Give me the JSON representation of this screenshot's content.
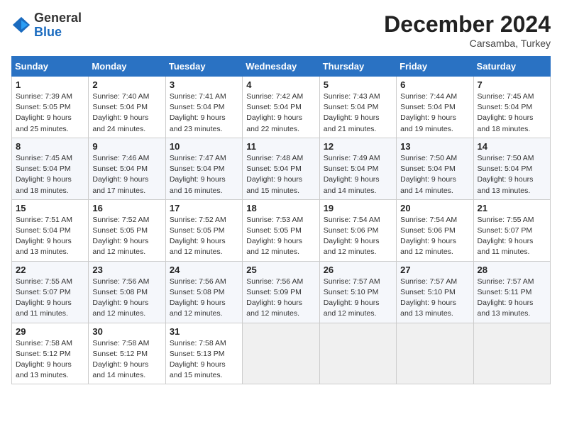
{
  "header": {
    "logo_line1": "General",
    "logo_line2": "Blue",
    "month_title": "December 2024",
    "location": "Carsamba, Turkey"
  },
  "weekdays": [
    "Sunday",
    "Monday",
    "Tuesday",
    "Wednesday",
    "Thursday",
    "Friday",
    "Saturday"
  ],
  "weeks": [
    [
      {
        "day": "1",
        "sunrise": "Sunrise: 7:39 AM",
        "sunset": "Sunset: 5:05 PM",
        "daylight": "Daylight: 9 hours and 25 minutes."
      },
      {
        "day": "2",
        "sunrise": "Sunrise: 7:40 AM",
        "sunset": "Sunset: 5:04 PM",
        "daylight": "Daylight: 9 hours and 24 minutes."
      },
      {
        "day": "3",
        "sunrise": "Sunrise: 7:41 AM",
        "sunset": "Sunset: 5:04 PM",
        "daylight": "Daylight: 9 hours and 23 minutes."
      },
      {
        "day": "4",
        "sunrise": "Sunrise: 7:42 AM",
        "sunset": "Sunset: 5:04 PM",
        "daylight": "Daylight: 9 hours and 22 minutes."
      },
      {
        "day": "5",
        "sunrise": "Sunrise: 7:43 AM",
        "sunset": "Sunset: 5:04 PM",
        "daylight": "Daylight: 9 hours and 21 minutes."
      },
      {
        "day": "6",
        "sunrise": "Sunrise: 7:44 AM",
        "sunset": "Sunset: 5:04 PM",
        "daylight": "Daylight: 9 hours and 19 minutes."
      },
      {
        "day": "7",
        "sunrise": "Sunrise: 7:45 AM",
        "sunset": "Sunset: 5:04 PM",
        "daylight": "Daylight: 9 hours and 18 minutes."
      }
    ],
    [
      {
        "day": "8",
        "sunrise": "Sunrise: 7:45 AM",
        "sunset": "Sunset: 5:04 PM",
        "daylight": "Daylight: 9 hours and 18 minutes."
      },
      {
        "day": "9",
        "sunrise": "Sunrise: 7:46 AM",
        "sunset": "Sunset: 5:04 PM",
        "daylight": "Daylight: 9 hours and 17 minutes."
      },
      {
        "day": "10",
        "sunrise": "Sunrise: 7:47 AM",
        "sunset": "Sunset: 5:04 PM",
        "daylight": "Daylight: 9 hours and 16 minutes."
      },
      {
        "day": "11",
        "sunrise": "Sunrise: 7:48 AM",
        "sunset": "Sunset: 5:04 PM",
        "daylight": "Daylight: 9 hours and 15 minutes."
      },
      {
        "day": "12",
        "sunrise": "Sunrise: 7:49 AM",
        "sunset": "Sunset: 5:04 PM",
        "daylight": "Daylight: 9 hours and 14 minutes."
      },
      {
        "day": "13",
        "sunrise": "Sunrise: 7:50 AM",
        "sunset": "Sunset: 5:04 PM",
        "daylight": "Daylight: 9 hours and 14 minutes."
      },
      {
        "day": "14",
        "sunrise": "Sunrise: 7:50 AM",
        "sunset": "Sunset: 5:04 PM",
        "daylight": "Daylight: 9 hours and 13 minutes."
      }
    ],
    [
      {
        "day": "15",
        "sunrise": "Sunrise: 7:51 AM",
        "sunset": "Sunset: 5:04 PM",
        "daylight": "Daylight: 9 hours and 13 minutes."
      },
      {
        "day": "16",
        "sunrise": "Sunrise: 7:52 AM",
        "sunset": "Sunset: 5:05 PM",
        "daylight": "Daylight: 9 hours and 12 minutes."
      },
      {
        "day": "17",
        "sunrise": "Sunrise: 7:52 AM",
        "sunset": "Sunset: 5:05 PM",
        "daylight": "Daylight: 9 hours and 12 minutes."
      },
      {
        "day": "18",
        "sunrise": "Sunrise: 7:53 AM",
        "sunset": "Sunset: 5:05 PM",
        "daylight": "Daylight: 9 hours and 12 minutes."
      },
      {
        "day": "19",
        "sunrise": "Sunrise: 7:54 AM",
        "sunset": "Sunset: 5:06 PM",
        "daylight": "Daylight: 9 hours and 12 minutes."
      },
      {
        "day": "20",
        "sunrise": "Sunrise: 7:54 AM",
        "sunset": "Sunset: 5:06 PM",
        "daylight": "Daylight: 9 hours and 12 minutes."
      },
      {
        "day": "21",
        "sunrise": "Sunrise: 7:55 AM",
        "sunset": "Sunset: 5:07 PM",
        "daylight": "Daylight: 9 hours and 11 minutes."
      }
    ],
    [
      {
        "day": "22",
        "sunrise": "Sunrise: 7:55 AM",
        "sunset": "Sunset: 5:07 PM",
        "daylight": "Daylight: 9 hours and 11 minutes."
      },
      {
        "day": "23",
        "sunrise": "Sunrise: 7:56 AM",
        "sunset": "Sunset: 5:08 PM",
        "daylight": "Daylight: 9 hours and 12 minutes."
      },
      {
        "day": "24",
        "sunrise": "Sunrise: 7:56 AM",
        "sunset": "Sunset: 5:08 PM",
        "daylight": "Daylight: 9 hours and 12 minutes."
      },
      {
        "day": "25",
        "sunrise": "Sunrise: 7:56 AM",
        "sunset": "Sunset: 5:09 PM",
        "daylight": "Daylight: 9 hours and 12 minutes."
      },
      {
        "day": "26",
        "sunrise": "Sunrise: 7:57 AM",
        "sunset": "Sunset: 5:10 PM",
        "daylight": "Daylight: 9 hours and 12 minutes."
      },
      {
        "day": "27",
        "sunrise": "Sunrise: 7:57 AM",
        "sunset": "Sunset: 5:10 PM",
        "daylight": "Daylight: 9 hours and 13 minutes."
      },
      {
        "day": "28",
        "sunrise": "Sunrise: 7:57 AM",
        "sunset": "Sunset: 5:11 PM",
        "daylight": "Daylight: 9 hours and 13 minutes."
      }
    ],
    [
      {
        "day": "29",
        "sunrise": "Sunrise: 7:58 AM",
        "sunset": "Sunset: 5:12 PM",
        "daylight": "Daylight: 9 hours and 13 minutes."
      },
      {
        "day": "30",
        "sunrise": "Sunrise: 7:58 AM",
        "sunset": "Sunset: 5:12 PM",
        "daylight": "Daylight: 9 hours and 14 minutes."
      },
      {
        "day": "31",
        "sunrise": "Sunrise: 7:58 AM",
        "sunset": "Sunset: 5:13 PM",
        "daylight": "Daylight: 9 hours and 15 minutes."
      },
      {
        "day": "",
        "sunrise": "",
        "sunset": "",
        "daylight": ""
      },
      {
        "day": "",
        "sunrise": "",
        "sunset": "",
        "daylight": ""
      },
      {
        "day": "",
        "sunrise": "",
        "sunset": "",
        "daylight": ""
      },
      {
        "day": "",
        "sunrise": "",
        "sunset": "",
        "daylight": ""
      }
    ]
  ]
}
